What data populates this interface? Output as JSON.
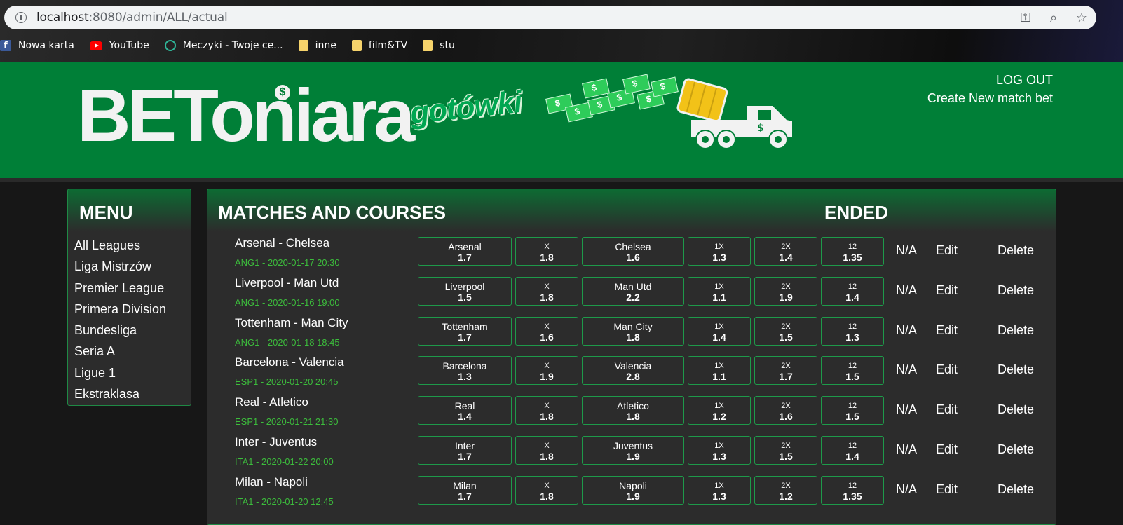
{
  "browser": {
    "url_host": "localhost",
    "url_path": ":8080/admin/ALL/actual",
    "bookmarks": [
      {
        "label": "Nowa karta",
        "icon": "facebook-icon"
      },
      {
        "label": "YouTube",
        "icon": "youtube-icon"
      },
      {
        "label": "Meczyki - Twoje ce...",
        "icon": "meczyki-icon"
      },
      {
        "label": "inne",
        "icon": "folder-icon"
      },
      {
        "label": "film&TV",
        "icon": "folder-icon"
      },
      {
        "label": "stu",
        "icon": "folder-icon"
      }
    ]
  },
  "header": {
    "logo": "BEToniara",
    "slogan": "gotówki",
    "logout": "LOG OUT",
    "create": "Create New match bet"
  },
  "menu": {
    "title": "MENU",
    "items": [
      "All Leagues",
      "Liga Mistrzów",
      "Premier League",
      "Primera Division",
      "Bundesliga",
      "Seria A",
      "Ligue 1",
      "Ekstraklasa"
    ]
  },
  "main": {
    "title": "MATCHES AND COURSES",
    "ended_title": "ENDED",
    "labels": {
      "x": "X",
      "x1": "1X",
      "x2": "2X",
      "x12": "12",
      "na": "N/A",
      "edit": "Edit",
      "delete": "Delete"
    },
    "matches": [
      {
        "name": "Arsenal - Chelsea",
        "meta": "ANG1 - 2020-01-17 20:30",
        "home": "Arsenal",
        "away": "Chelsea",
        "o1": "1.7",
        "ox": "1.8",
        "o2": "1.6",
        "o1x": "1.3",
        "o2x": "1.4",
        "o12": "1.35"
      },
      {
        "name": "Liverpool - Man Utd",
        "meta": "ANG1 - 2020-01-16 19:00",
        "home": "Liverpool",
        "away": "Man Utd",
        "o1": "1.5",
        "ox": "1.8",
        "o2": "2.2",
        "o1x": "1.1",
        "o2x": "1.9",
        "o12": "1.4"
      },
      {
        "name": "Tottenham - Man City",
        "meta": "ANG1 - 2020-01-18 18:45",
        "home": "Tottenham",
        "away": "Man City",
        "o1": "1.7",
        "ox": "1.6",
        "o2": "1.8",
        "o1x": "1.4",
        "o2x": "1.5",
        "o12": "1.3"
      },
      {
        "name": "Barcelona - Valencia",
        "meta": "ESP1 - 2020-01-20 20:45",
        "home": "Barcelona",
        "away": "Valencia",
        "o1": "1.3",
        "ox": "1.9",
        "o2": "2.8",
        "o1x": "1.1",
        "o2x": "1.7",
        "o12": "1.5"
      },
      {
        "name": "Real - Atletico",
        "meta": "ESP1 - 2020-01-21 21:30",
        "home": "Real",
        "away": "Atletico",
        "o1": "1.4",
        "ox": "1.8",
        "o2": "1.8",
        "o1x": "1.2",
        "o2x": "1.6",
        "o12": "1.5"
      },
      {
        "name": "Inter - Juventus",
        "meta": "ITA1 - 2020-01-22 20:00",
        "home": "Inter",
        "away": "Juventus",
        "o1": "1.7",
        "ox": "1.8",
        "o2": "1.9",
        "o1x": "1.3",
        "o2x": "1.5",
        "o12": "1.4"
      },
      {
        "name": "Milan - Napoli",
        "meta": "ITA1 - 2020-01-20 12:45",
        "home": "Milan",
        "away": "Napoli",
        "o1": "1.7",
        "ox": "1.8",
        "o2": "1.9",
        "o1x": "1.3",
        "o2x": "1.2",
        "o12": "1.35"
      }
    ]
  }
}
